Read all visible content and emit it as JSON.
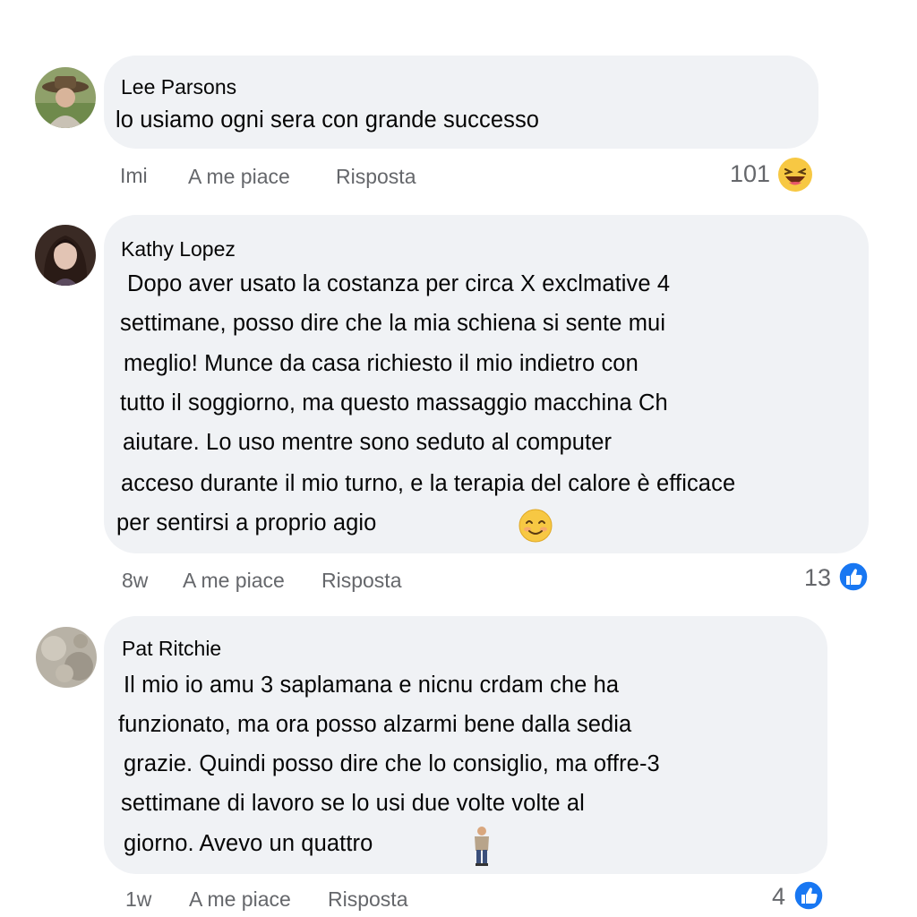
{
  "comments": [
    {
      "author": "Lee Parsons",
      "lines": [
        "lo usiamo ogni sera con grande successo"
      ],
      "time": "Imi",
      "like_label": "A me piace",
      "reply_label": "Risposta",
      "reaction_count": "101",
      "reaction_icon": "laughing-face-icon"
    },
    {
      "author": "Kathy Lopez",
      "lines": [
        "Dopo aver usato la costanza per circa X exclmative 4",
        "settimane, posso dire che la mia schiena si sente mui",
        "meglio! Munce da casa richiesto il mio indietro con",
        "tutto il soggiorno, ma questo massaggio macchina Ch",
        "aiutare. Lo uso mentre sono seduto al computer",
        "acceso durante il mio turno, e la terapia del calore è efficace",
        "per sentirsi a proprio agio"
      ],
      "time": "8w",
      "like_label": "A me piace",
      "reply_label": "Risposta",
      "reaction_count": "13",
      "reaction_icon": "like-thumb-icon"
    },
    {
      "author": "Pat Ritchie",
      "lines": [
        "Il mio io amu 3 saplamana e nicnu crdam che ha",
        "funzionato, ma ora posso alzarmi bene dalla sedia",
        "grazie. Quindi posso dire che lo consiglio, ma offre-3",
        "settimane di lavoro se lo usi due volte volte al",
        "giorno. Avevo un quattro"
      ],
      "time": "1w",
      "like_label": "A me piace",
      "reply_label": "Risposta",
      "reaction_count": "4",
      "reaction_icon": "like-thumb-icon"
    }
  ],
  "colors": {
    "bubble": "#f0f2f5",
    "meta_text": "#65676b",
    "like_blue": "#1877f2",
    "emoji_yellow": "#f7c843"
  }
}
